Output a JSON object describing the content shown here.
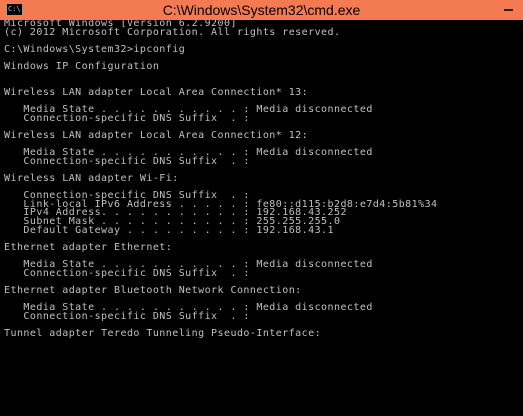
{
  "window": {
    "title": "C:\\Windows\\System32\\cmd.exe",
    "icon_text": "C:\\"
  },
  "console": {
    "lines": [
      "Microsoft Windows [Version 6.2.9200]",
      "(c) 2012 Microsoft Corporation. All rights reserved.",
      "",
      "C:\\Windows\\System32>ipconfig",
      "",
      "Windows IP Configuration",
      "",
      "",
      "Wireless LAN adapter Local Area Connection* 13:",
      "",
      "   Media State . . . . . . . . . . . : Media disconnected",
      "   Connection-specific DNS Suffix  . :",
      "",
      "Wireless LAN adapter Local Area Connection* 12:",
      "",
      "   Media State . . . . . . . . . . . : Media disconnected",
      "   Connection-specific DNS Suffix  . :",
      "",
      "Wireless LAN adapter Wi-Fi:",
      "",
      "   Connection-specific DNS Suffix  . :",
      "   Link-local IPv6 Address . . . . . : fe80::d115:b2d8:e7d4:5b81%34",
      "   IPv4 Address. . . . . . . . . . . : 192.168.43.252",
      "   Subnet Mask . . . . . . . . . . . : 255.255.255.0",
      "   Default Gateway . . . . . . . . . : 192.168.43.1",
      "",
      "Ethernet adapter Ethernet:",
      "",
      "   Media State . . . . . . . . . . . : Media disconnected",
      "   Connection-specific DNS Suffix  . :",
      "",
      "Ethernet adapter Bluetooth Network Connection:",
      "",
      "   Media State . . . . . . . . . . . : Media disconnected",
      "   Connection-specific DNS Suffix  . :",
      "",
      "Tunnel adapter Teredo Tunneling Pseudo-Interface:"
    ]
  }
}
